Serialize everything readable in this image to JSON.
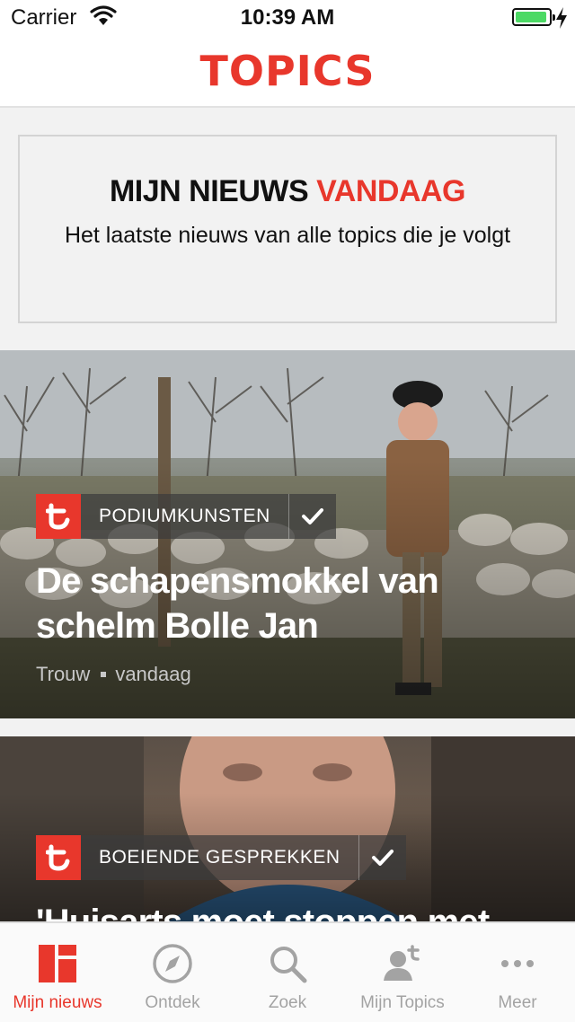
{
  "status_bar": {
    "carrier": "Carrier",
    "time": "10:39 AM",
    "battery_level": 0.95
  },
  "header": {
    "logo": "TOPICS"
  },
  "intro": {
    "title_part1": "MIJN NIEUWS",
    "title_part2": "VANDAAG",
    "subtitle": "Het laatste nieuws van alle topics die je volgt"
  },
  "articles": [
    {
      "topic": "PODIUMKUNSTEN",
      "headline": "De schapensmokkel van schelm Bolle Jan",
      "source": "Trouw",
      "time": "vandaag"
    },
    {
      "topic": "BOEIENDE GESPREKKEN",
      "headline": "'Huisarts moet stoppen met"
    }
  ],
  "tabs": [
    {
      "label": "Mijn nieuws",
      "icon": "dashboard-icon",
      "active": true
    },
    {
      "label": "Ontdek",
      "icon": "compass-icon"
    },
    {
      "label": "Zoek",
      "icon": "search-icon"
    },
    {
      "label": "Mijn Topics",
      "icon": "user-topics-icon"
    },
    {
      "label": "Meer",
      "icon": "more-icon"
    }
  ],
  "colors": {
    "accent": "#e8372c",
    "inactive": "#a3a3a3"
  }
}
